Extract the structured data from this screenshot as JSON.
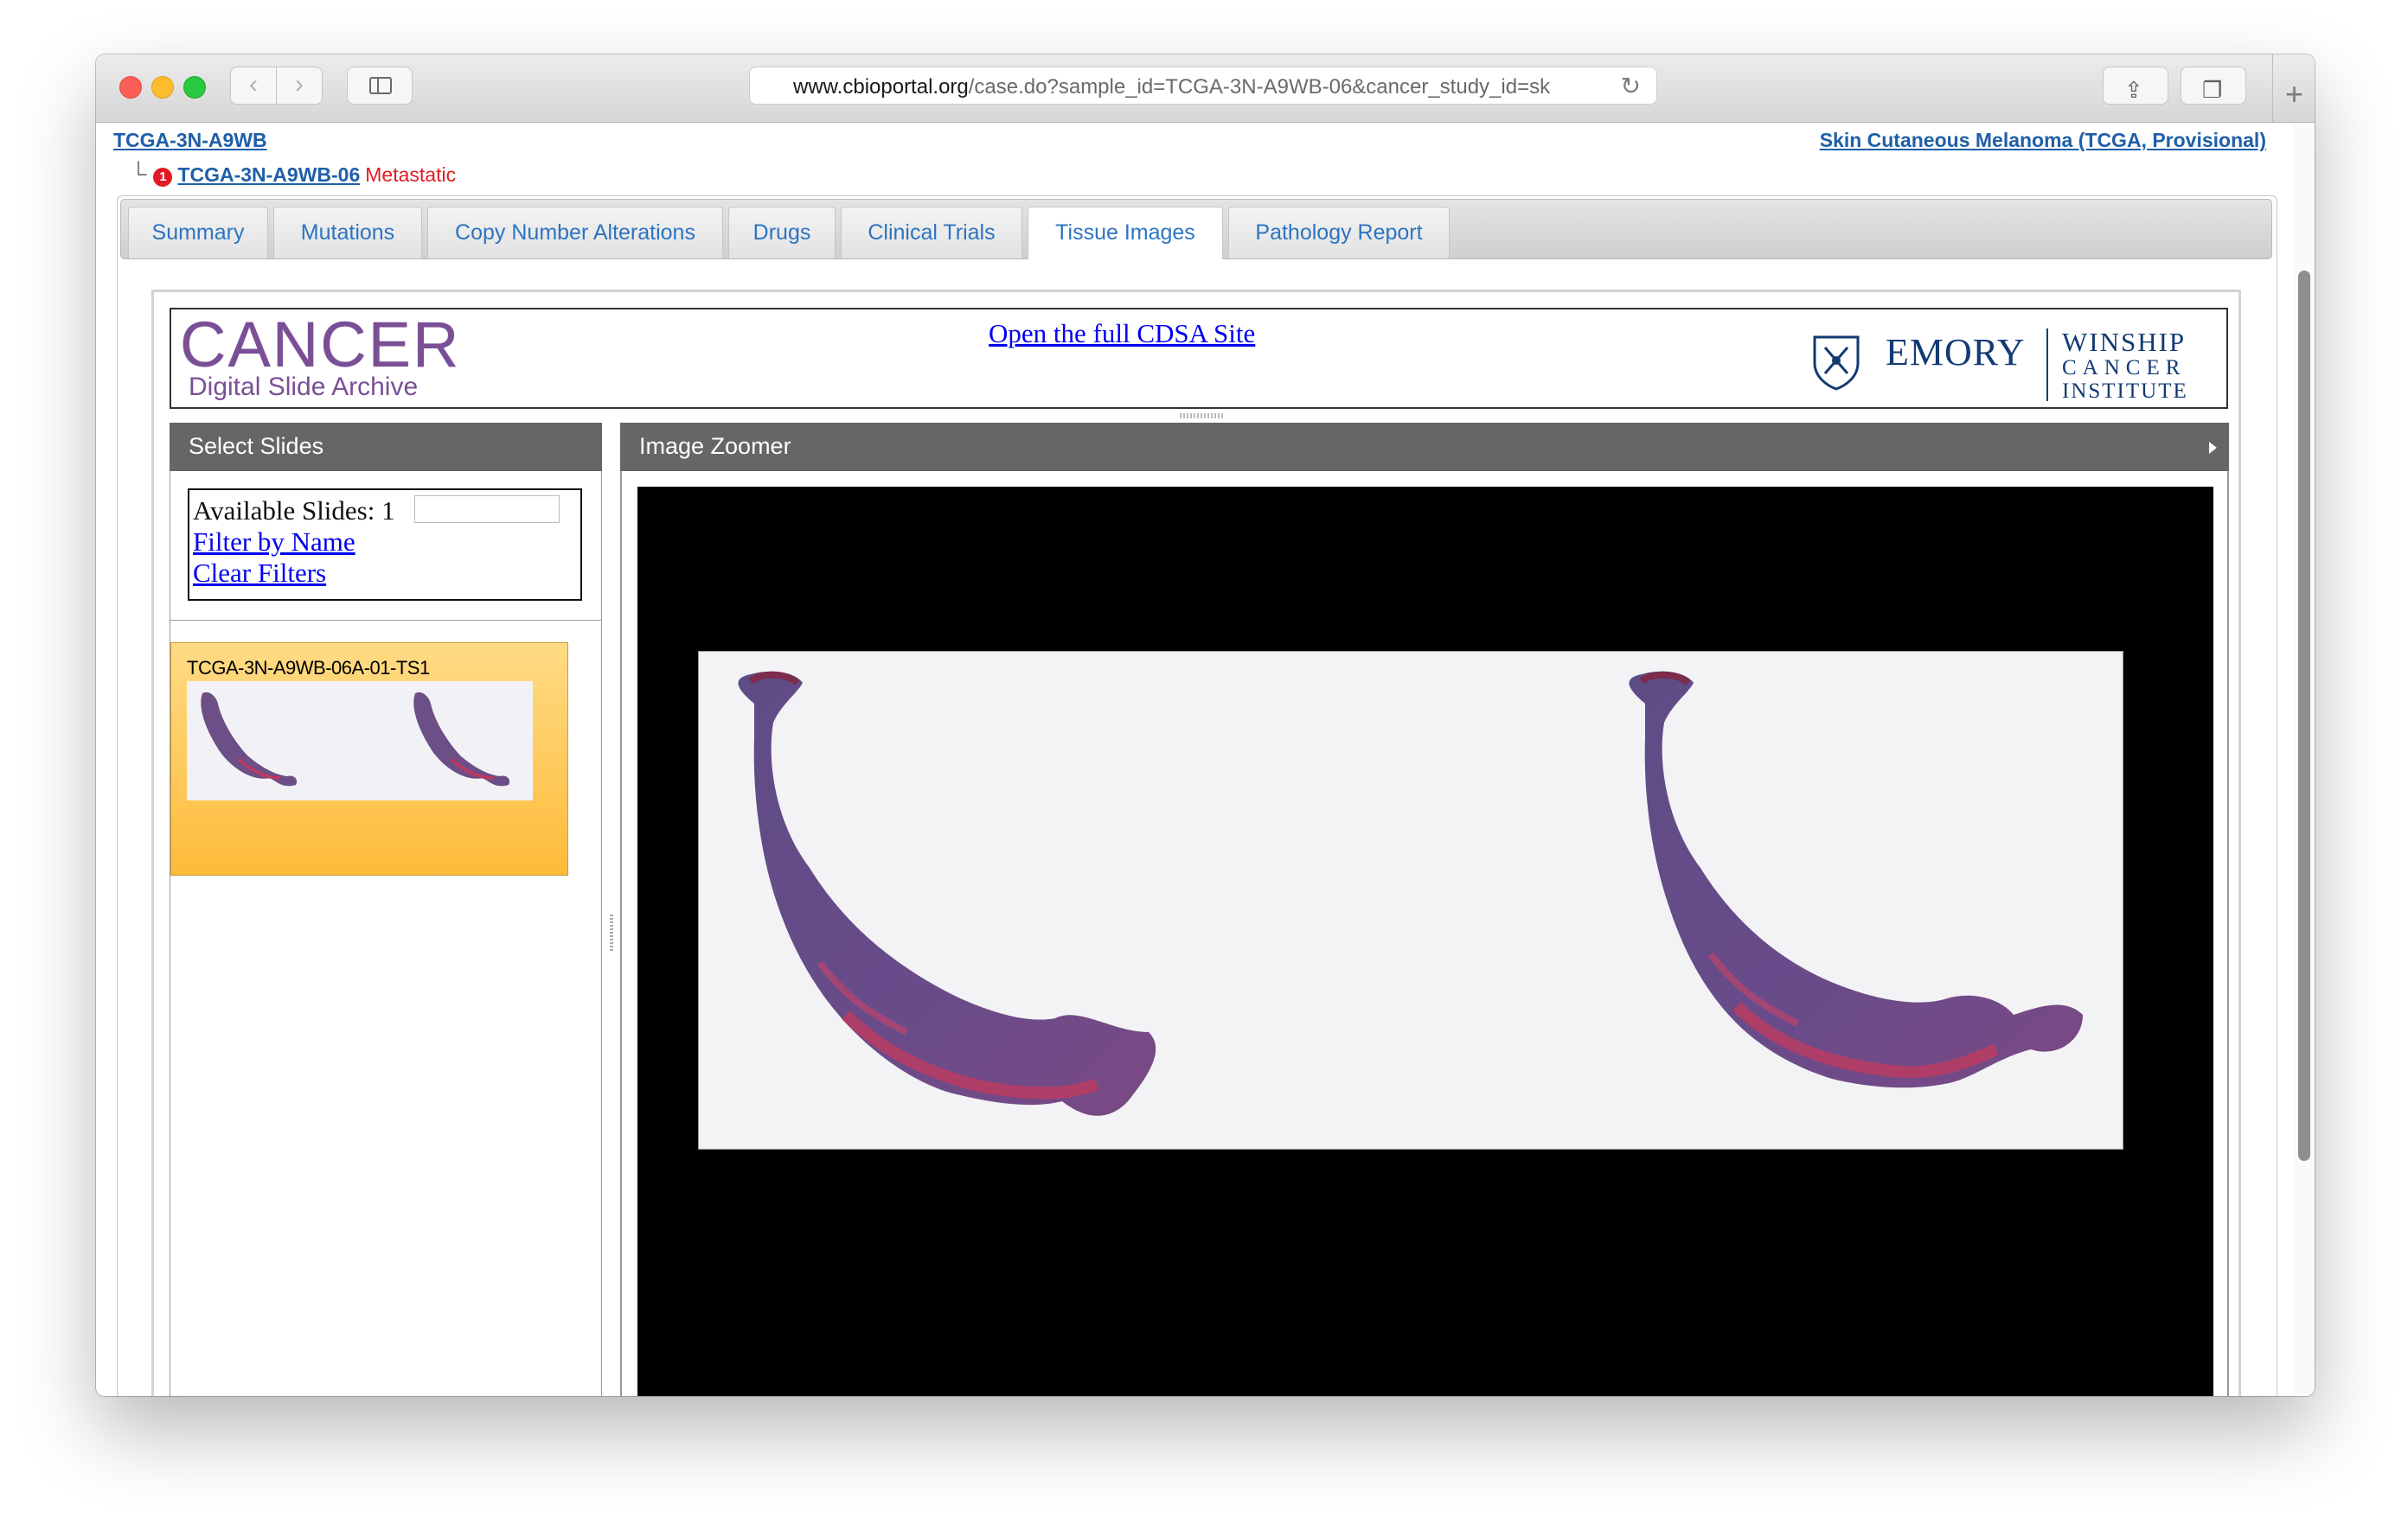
{
  "browser": {
    "url_host": "www.cbioportal.org",
    "url_path": "/case.do?sample_id=TCGA-3N-A9WB-06&cancer_study_id=sk"
  },
  "header": {
    "patient_id": "TCGA-3N-A9WB",
    "sample_id": "TCGA-3N-A9WB-06",
    "sample_badge": "1",
    "sample_type": "Metastatic",
    "study_name": "Skin Cutaneous Melanoma (TCGA, Provisional)"
  },
  "tabs": [
    {
      "label": "Summary"
    },
    {
      "label": "Mutations"
    },
    {
      "label": "Copy Number Alterations"
    },
    {
      "label": "Drugs"
    },
    {
      "label": "Clinical Trials"
    },
    {
      "label": "Tissue Images"
    },
    {
      "label": "Pathology Report"
    }
  ],
  "active_tab": "Tissue Images",
  "cdsa": {
    "logo_big": "CANCER",
    "logo_small": "Digital Slide Archive",
    "open_link": "Open the full CDSA Site",
    "emory": "EMORY",
    "winship_1": "WINSHIP",
    "winship_2": "CANCER",
    "winship_3": "INSTITUTE"
  },
  "select_slides": {
    "title": "Select Slides",
    "available_label": "Available Slides: 1",
    "filter_placeholder": "",
    "filter_link": "Filter by Name",
    "clear_link": "Clear Filters",
    "slides": [
      {
        "label": "TCGA-3N-A9WB-06A-01-TS1"
      }
    ]
  },
  "zoomer": {
    "title": "Image Zoomer"
  },
  "colors": {
    "link_blue": "#1f5fa8",
    "tab_text": "#2c74c2",
    "metastatic_red": "#e01b24",
    "cdsa_purple": "#7a4f96",
    "emory_navy": "#123a73",
    "slide_card": "#fdbb3a",
    "panel_header": "#666666"
  },
  "icons": [
    "back-icon",
    "forward-icon",
    "sidebar-icon",
    "reload-icon",
    "share-icon",
    "tabs-icon",
    "new-tab-icon",
    "emory-shield-icon",
    "collapse-arrow-icon"
  ]
}
